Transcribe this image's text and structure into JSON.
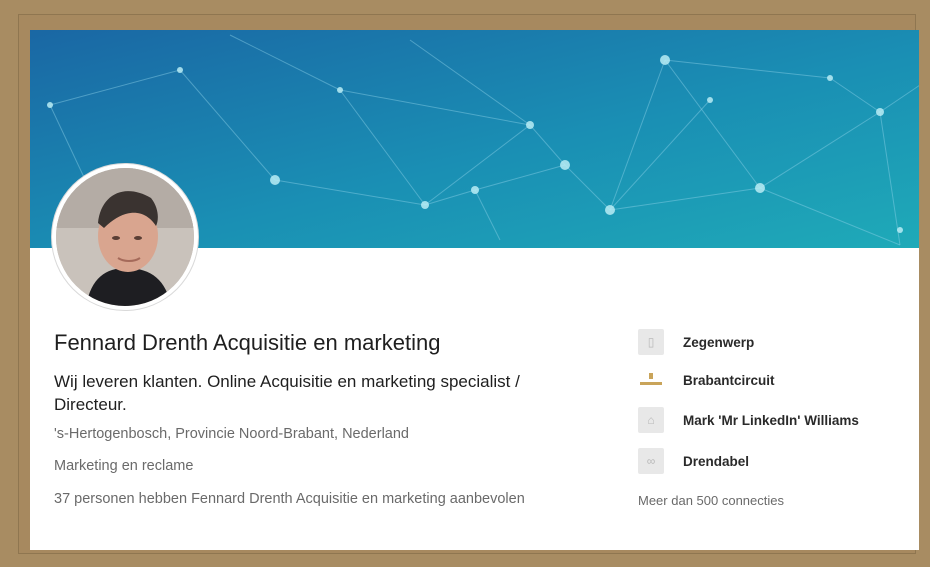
{
  "profile": {
    "name": "Fennard Drenth Acquisitie en marketing",
    "headline": "Wij leveren klanten. Online Acquisitie en marketing specialist / Directeur.",
    "location": "'s-Hertogenbosch, Provincie Noord-Brabant, Nederland",
    "industry": "Marketing en reclame",
    "recommendations": "37 personen hebben Fennard Drenth Acquisitie en marketing aanbevolen"
  },
  "sidebar": {
    "items": [
      {
        "label": "Zegenwerp",
        "icon": "building-icon"
      },
      {
        "label": "Brabantcircuit",
        "icon": "brabantcircuit-logo"
      },
      {
        "label": "Mark 'Mr LinkedIn' Williams",
        "icon": "school-icon"
      },
      {
        "label": "Drendabel",
        "icon": "link-icon"
      }
    ],
    "connections": "Meer dan 500 connecties"
  },
  "colors": {
    "banner_start": "#1b6aa6",
    "banner_end": "#1ba6b6",
    "frame": "#a88c62"
  }
}
